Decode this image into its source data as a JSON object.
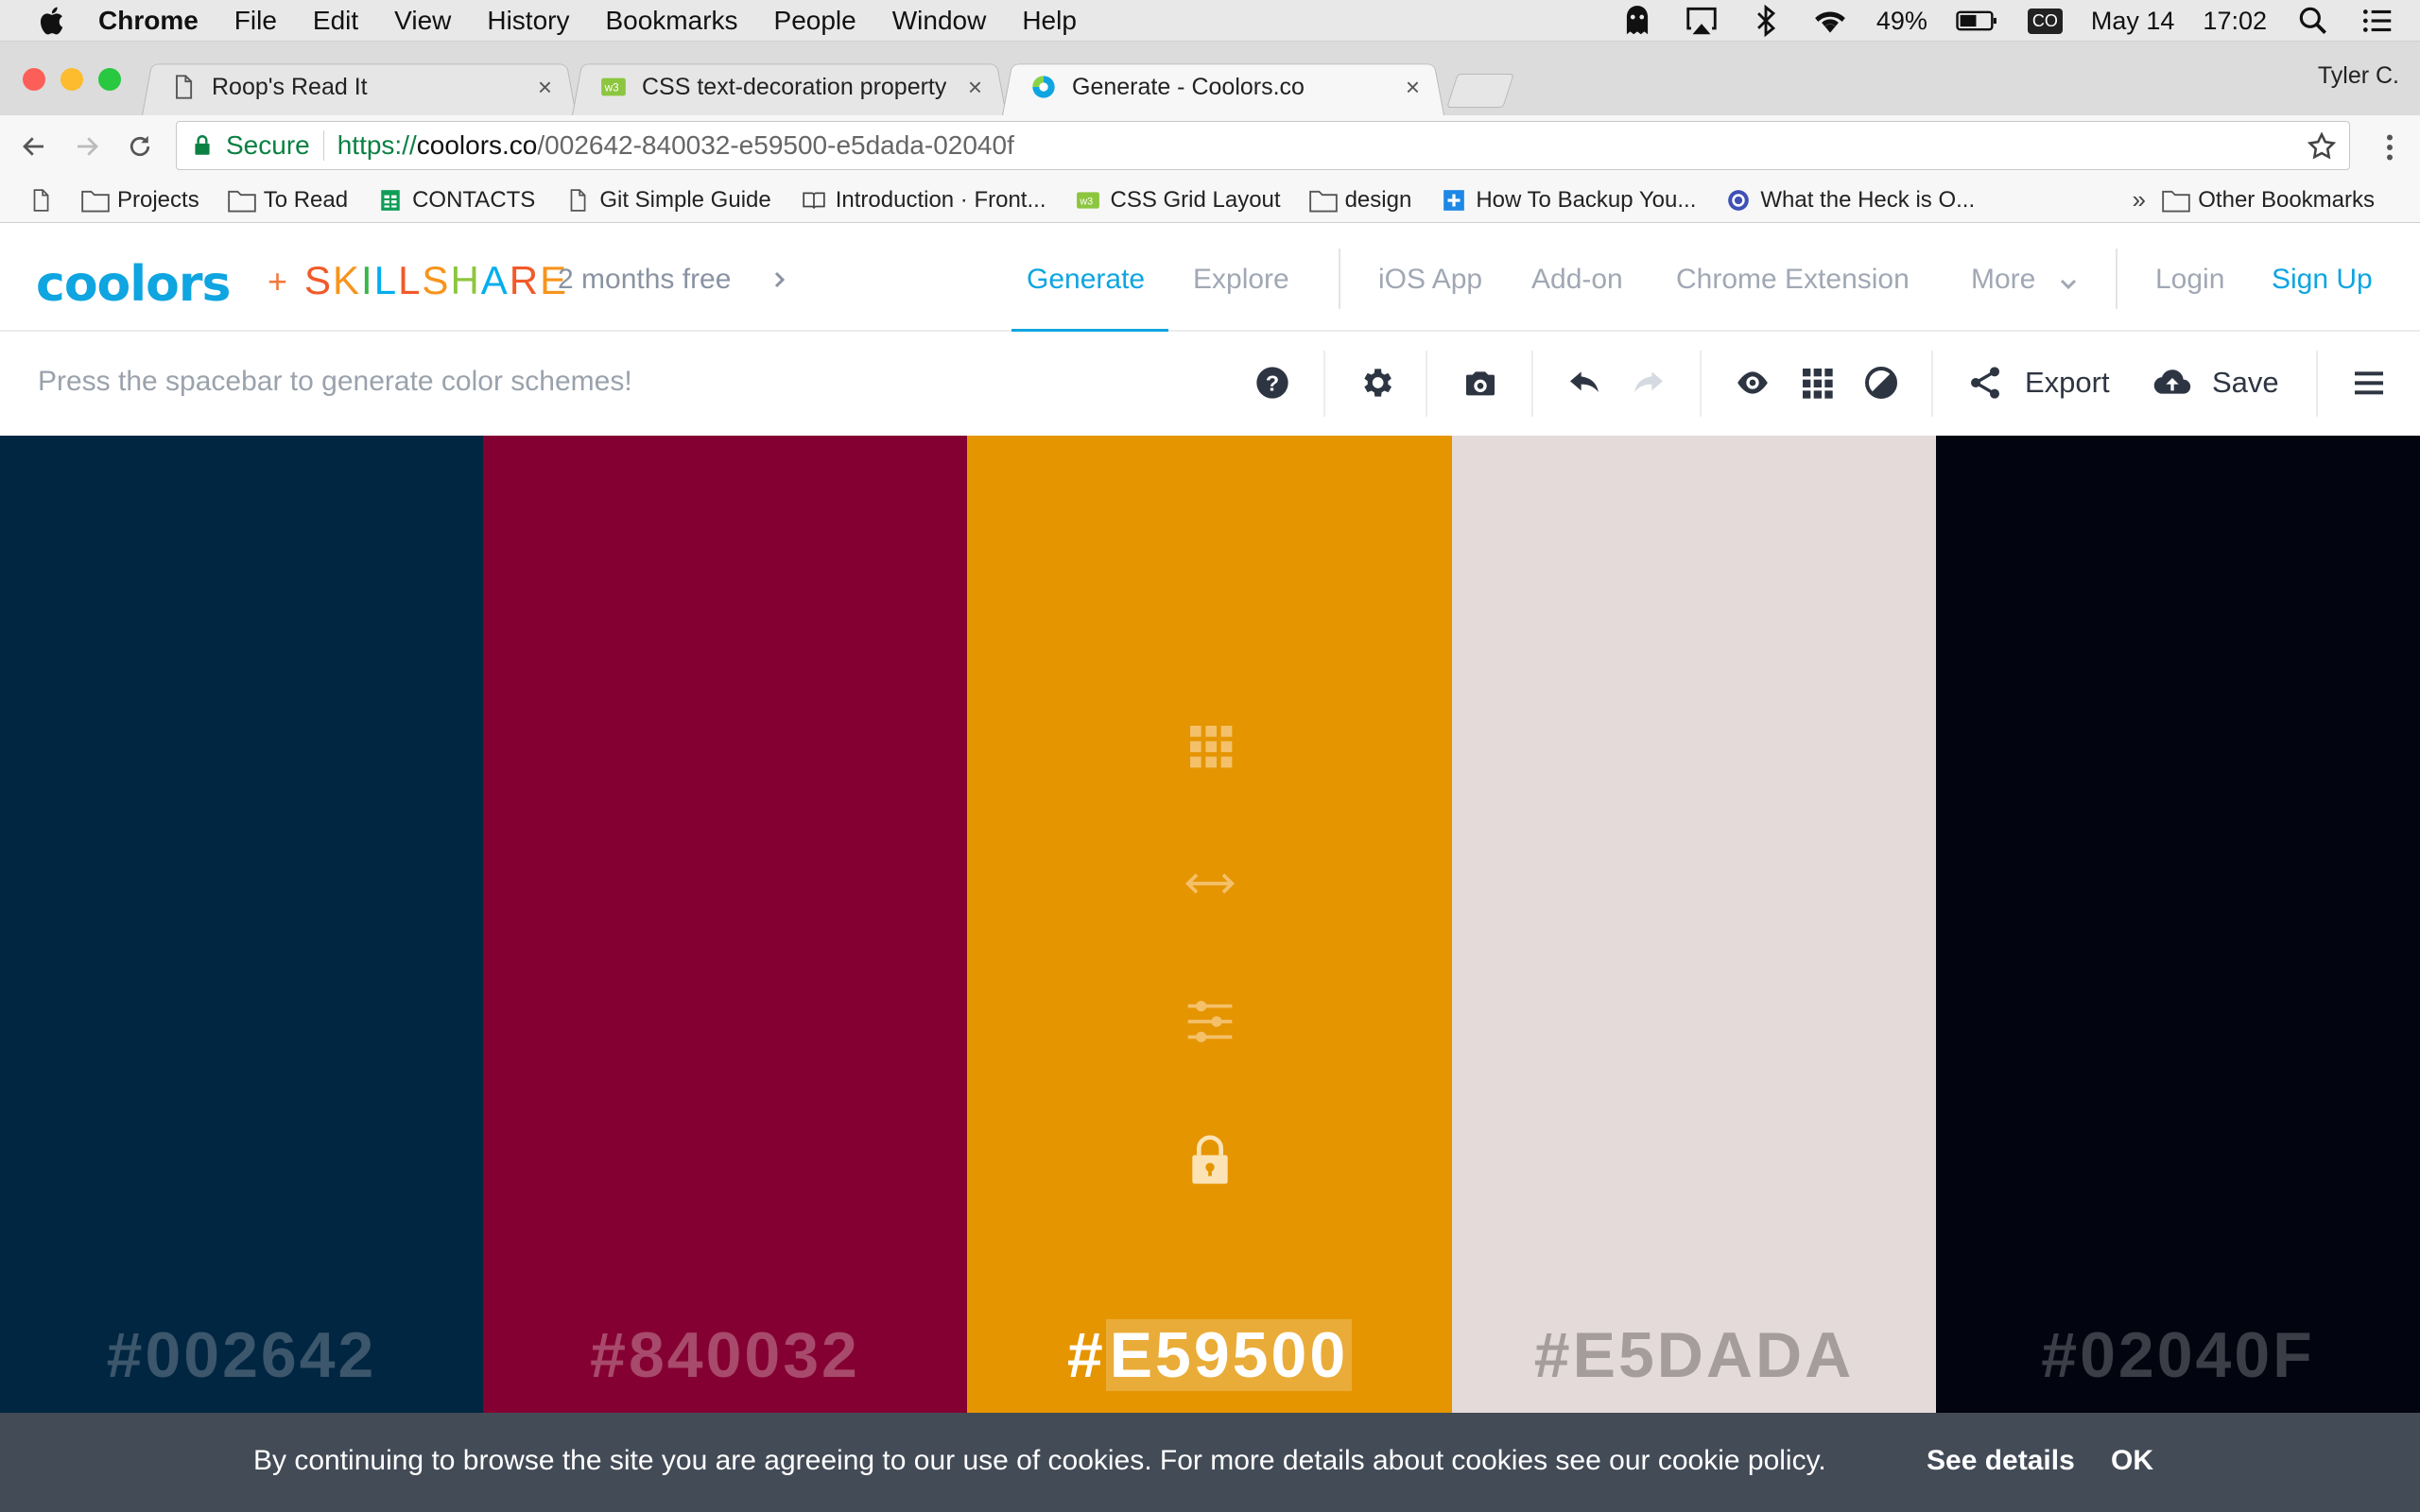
{
  "menubar": {
    "app": "Chrome",
    "items": [
      "File",
      "Edit",
      "View",
      "History",
      "Bookmarks",
      "People",
      "Window",
      "Help"
    ],
    "battery": "49%",
    "co_badge": "CO",
    "date": "May 14",
    "time": "17:02"
  },
  "tabs": [
    {
      "title": "Roop's Read It",
      "close": "×"
    },
    {
      "title": "CSS text-decoration property",
      "close": "×"
    },
    {
      "title": "Generate - Coolors.co",
      "close": "×"
    }
  ],
  "profile_name": "Tyler C.",
  "omnibox": {
    "secure_label": "Secure",
    "url_scheme": "https://",
    "url_host": "coolors.co",
    "url_path": "/002642-840032-e59500-e5dada-02040f"
  },
  "bookmarks": {
    "items": [
      "Projects",
      "To Read",
      "CONTACTS",
      "Git Simple Guide",
      "Introduction · Front...",
      "CSS Grid Layout",
      "design",
      "How To Backup You...",
      "What the Heck is O..."
    ],
    "more": "»",
    "other": "Other Bookmarks"
  },
  "site": {
    "logo": "coolors",
    "plus": "+",
    "skillshare_letters": [
      "S",
      "K",
      "I",
      "L",
      "L",
      "S",
      "H",
      "A",
      "R",
      "E"
    ],
    "skillshare_colors": [
      "#f15a29",
      "#f7941d",
      "#39b54a",
      "#00aeef",
      "#f15a29",
      "#f7941d",
      "#8dc63f",
      "#00aeef",
      "#f15a29",
      "#f7941d"
    ],
    "promo": "2 months free",
    "nav": [
      "Generate",
      "Explore",
      "iOS App",
      "Add-on",
      "Chrome Extension",
      "More",
      "Login",
      "Sign Up"
    ]
  },
  "generator": {
    "hint": "Press the spacebar to generate color schemes!",
    "export_label": "Export",
    "save_label": "Save"
  },
  "palette": [
    {
      "hex": "#002642",
      "label": "#002642",
      "text_color": "#3c566b"
    },
    {
      "hex": "#840032",
      "label": "#840032",
      "text_color": "#a84a6b"
    },
    {
      "hex": "#E59500",
      "label_hash": "#",
      "label_rest": "E59500",
      "text_color": "#ffffff"
    },
    {
      "hex": "#E5DADA",
      "label": "#E5DADA",
      "text_color": "#a59c9c"
    },
    {
      "hex": "#02040F",
      "label": "#02040F",
      "text_color": "#3b3e47"
    }
  ],
  "cookie": {
    "message": "By continuing to browse the site you are agreeing to our use of cookies. For more details about cookies see our cookie policy.",
    "see_details": "See details",
    "ok": "OK"
  }
}
